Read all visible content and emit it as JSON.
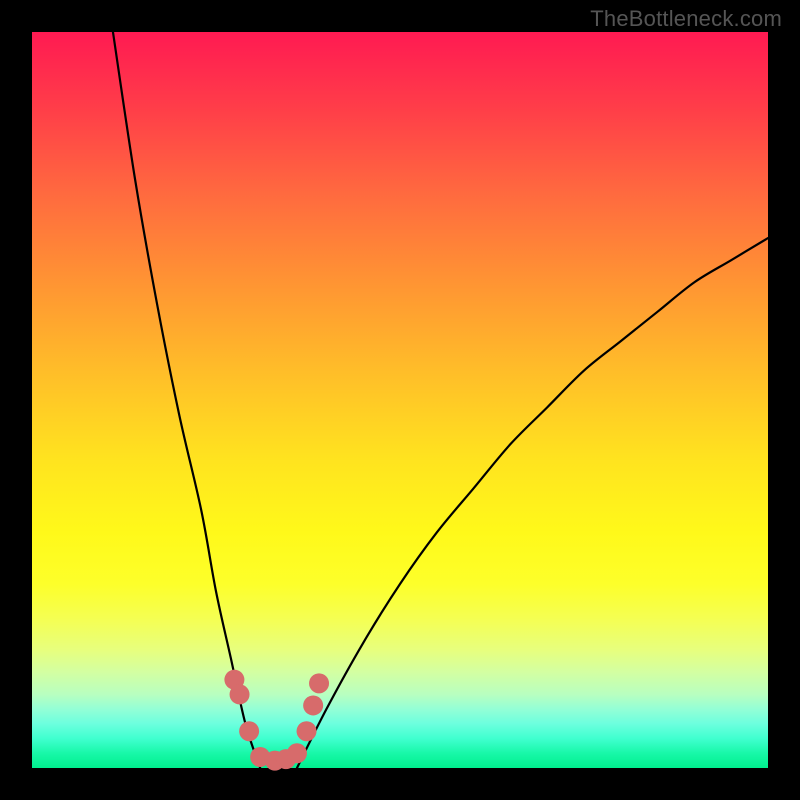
{
  "watermark": "TheBottleneck.com",
  "colors": {
    "marker": "#d76b6b",
    "curve": "#000000",
    "background_top": "#ff1a52",
    "background_bottom": "#00ef8e"
  },
  "chart_data": {
    "type": "line",
    "title": "",
    "xlabel": "",
    "ylabel": "",
    "xlim": [
      0,
      100
    ],
    "ylim": [
      0,
      100
    ],
    "note": "V-shaped bottleneck curve; minimum (0%) around x≈31–36. Left branch rises to 100% at x≈11, right branch rises to ~72% at x=100.",
    "series": [
      {
        "name": "left-branch",
        "x": [
          11,
          14,
          17,
          20,
          23,
          25,
          27,
          29,
          31
        ],
        "values": [
          100,
          80,
          63,
          48,
          35,
          24,
          15,
          6,
          0
        ]
      },
      {
        "name": "right-branch",
        "x": [
          36,
          40,
          45,
          50,
          55,
          60,
          65,
          70,
          75,
          80,
          85,
          90,
          95,
          100
        ],
        "values": [
          0,
          8,
          17,
          25,
          32,
          38,
          44,
          49,
          54,
          58,
          62,
          66,
          69,
          72
        ]
      }
    ],
    "markers": {
      "name": "highlighted-points",
      "x": [
        27.5,
        28.2,
        29.5,
        31.0,
        33.0,
        34.5,
        36.0,
        37.3,
        38.2,
        39.0
      ],
      "y": [
        12.0,
        10.0,
        5.0,
        1.5,
        1.0,
        1.2,
        2.0,
        5.0,
        8.5,
        11.5
      ]
    }
  }
}
